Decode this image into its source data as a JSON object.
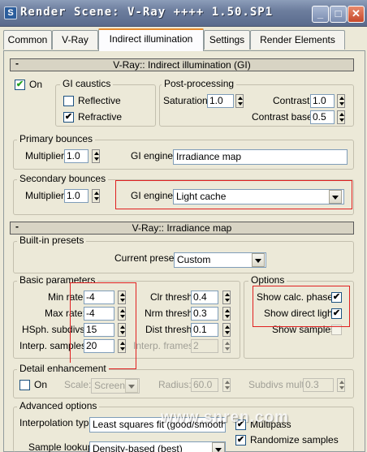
{
  "window": {
    "title": "Render Scene: V-Ray ++++ 1.50.SP1",
    "app_icon": "S"
  },
  "tabs": [
    {
      "label": "Common"
    },
    {
      "label": "V-Ray"
    },
    {
      "label": "Indirect illumination"
    },
    {
      "label": "Settings"
    },
    {
      "label": "Render Elements"
    }
  ],
  "active_tab": "Indirect illumination",
  "gi_rollout": {
    "title": "V-Ray:: Indirect illumination (GI)",
    "collapse": "-",
    "on_label": "On",
    "on_checked": true,
    "caustics": {
      "title": "GI caustics",
      "reflective": "Reflective",
      "reflective_checked": false,
      "refractive": "Refractive",
      "refractive_checked": true
    },
    "post": {
      "title": "Post-processing",
      "saturation_label": "Saturation:",
      "saturation": "1.0",
      "contrast_label": "Contrast:",
      "contrast": "1.0",
      "contrast_base_label": "Contrast base:",
      "contrast_base": "0.5"
    },
    "primary": {
      "title": "Primary bounces",
      "multiplier_label": "Multiplier:",
      "multiplier": "1.0",
      "engine_label": "GI engine:",
      "engine": "Irradiance map"
    },
    "secondary": {
      "title": "Secondary bounces",
      "multiplier_label": "Multiplier:",
      "multiplier": "1.0",
      "engine_label": "GI engine:",
      "engine": "Light cache"
    }
  },
  "irr_rollout": {
    "title": "V-Ray:: Irradiance map",
    "collapse": "-",
    "presets": {
      "title": "Built-in presets",
      "current_label": "Current preset:",
      "current": "Custom"
    },
    "basic": {
      "title": "Basic parameters",
      "min_rate_label": "Min rate:",
      "min_rate": "-4",
      "max_rate_label": "Max rate:",
      "max_rate": "-4",
      "hsph_label": "HSph. subdivs:",
      "hsph": "15",
      "interp_label": "Interp. samples:",
      "interp": "20",
      "clr_label": "Clr thresh:",
      "clr": "0.4",
      "nrm_label": "Nrm thresh:",
      "nrm": "0.3",
      "dist_label": "Dist thresh:",
      "dist": "0.1",
      "frames_label": "Interp. frames:",
      "frames": "2"
    },
    "options": {
      "title": "Options",
      "show_calc": "Show calc. phase",
      "show_calc_checked": true,
      "show_direct": "Show direct light",
      "show_direct_checked": true,
      "show_samples": "Show samples",
      "show_samples_checked": false
    },
    "detail": {
      "title": "Detail enhancement",
      "on_label": "On",
      "on_checked": false,
      "scale_label": "Scale:",
      "scale": "Screen",
      "radius_label": "Radius:",
      "radius": "60.0",
      "subdivs_label": "Subdivs mult.",
      "subdivs": "0.3"
    },
    "advanced": {
      "title": "Advanced options",
      "interp_type_label": "Interpolation type:",
      "interp_type": "Least squares fit (good/smooth",
      "lookup_label": "Sample lookup:",
      "lookup": "Density-based (best)",
      "multipass": "Multipass",
      "multipass_checked": true,
      "randomize": "Randomize samples",
      "randomize_checked": true
    }
  },
  "watermark": "www.snren.com",
  "colors": {
    "highlight": "#e02020",
    "titlebar": "#6d7e9e",
    "check": "#21a121"
  }
}
